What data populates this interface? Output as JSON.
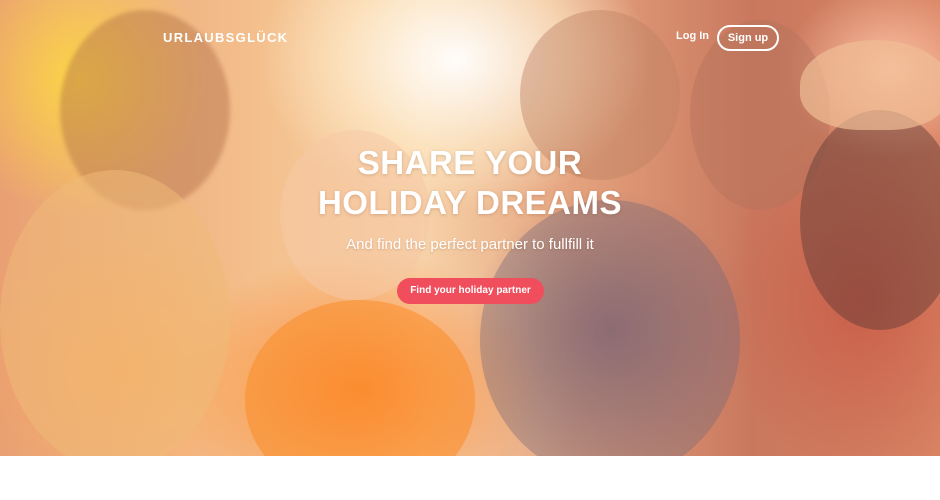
{
  "brand": {
    "logo_text": "URLAUBSGLÜCK"
  },
  "nav": {
    "login_label": "Log In",
    "signup_label": "Sign up"
  },
  "hero": {
    "headline_line1": "SHARE YOUR",
    "headline_line2": "HOLIDAY DREAMS",
    "subline": "And find the perfect partner to fullfill it",
    "cta_label": "Find your holiday partner"
  },
  "colors": {
    "cta_background": "#f04e5c",
    "text": "#ffffff",
    "page_background": "#ffffff"
  }
}
